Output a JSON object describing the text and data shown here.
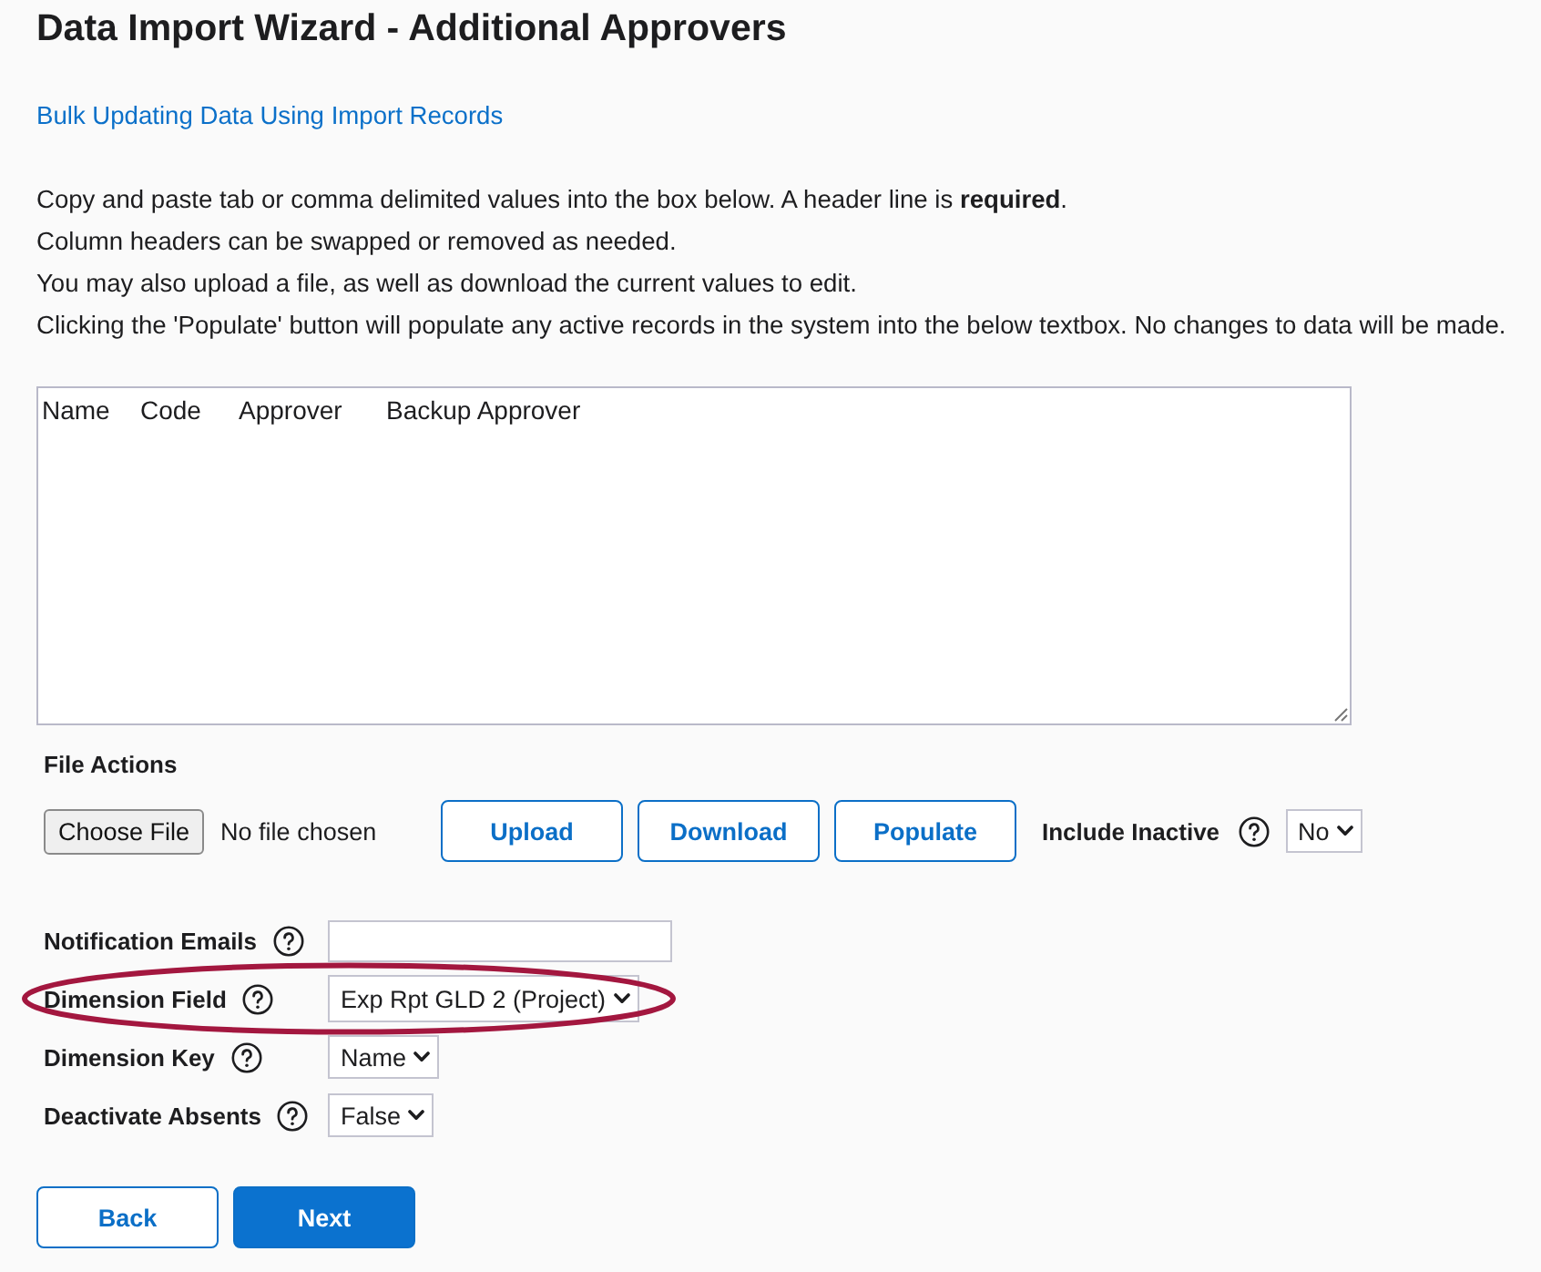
{
  "title": "Data Import Wizard - Additional Approvers",
  "help_link": "Bulk Updating Data Using Import Records",
  "instructions": [
    "Copy and paste tab or comma delimited values into the box below. A header line is **required**.",
    "Column headers can be swapped or removed as needed.",
    "You may also upload a file, as well as download the current values to edit.",
    "Clicking the 'Populate' button will populate any active records in the system into the below textbox. No changes to data will be made."
  ],
  "import_box": {
    "value": "Name\tCode\tApprover\tBackup Approver"
  },
  "file_actions": {
    "label": "File Actions",
    "file_button": "Choose File",
    "file_status": "No file chosen",
    "buttons": [
      "Upload",
      "Download",
      "Populate"
    ],
    "include_inactive": {
      "label": "Include Inactive",
      "value": "No"
    }
  },
  "fields": [
    {
      "kind": "text",
      "label": "Notification Emails",
      "highlighted": false
    },
    {
      "kind": "select",
      "label": "Dimension Field",
      "value": "Exp Rpt GLD 2 (Project)",
      "highlighted": true
    },
    {
      "kind": "select",
      "label": "Dimension Key",
      "value": "Name",
      "highlighted": false
    },
    {
      "kind": "select",
      "label": "Deactivate Absents",
      "value": "False",
      "highlighted": false
    }
  ],
  "nav_buttons": [
    {
      "kind": "secondary",
      "label": "Back"
    },
    {
      "kind": "primary",
      "label": "Next"
    }
  ]
}
